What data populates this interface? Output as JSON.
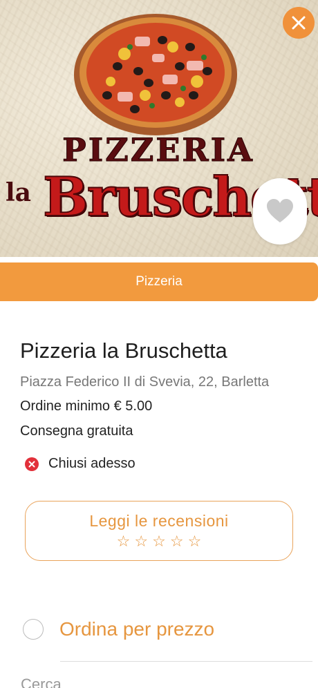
{
  "hero": {
    "logo_line1": "PIZZERIA",
    "logo_la": "la",
    "logo_line2": "Bruschetta"
  },
  "header": {
    "close_icon": "close-icon",
    "favorite_icon": "heart-icon"
  },
  "category": {
    "label": "Pizzeria"
  },
  "restaurant": {
    "name": "Pizzeria la Bruschetta",
    "address": "Piazza Federico II di Svevia, 22, Barletta",
    "min_order": "Ordine minimo € 5.00",
    "delivery": "Consegna gratuita",
    "status": "Chiusi adesso",
    "status_color": "#e2303a"
  },
  "reviews": {
    "label": "Leggi le recensioni",
    "rating": 0,
    "max_rating": 5
  },
  "sort": {
    "label": "Ordina per prezzo",
    "selected": false
  },
  "search": {
    "label": "Cerca"
  },
  "colors": {
    "accent": "#f29a3e",
    "accent_text": "#e6963f"
  }
}
